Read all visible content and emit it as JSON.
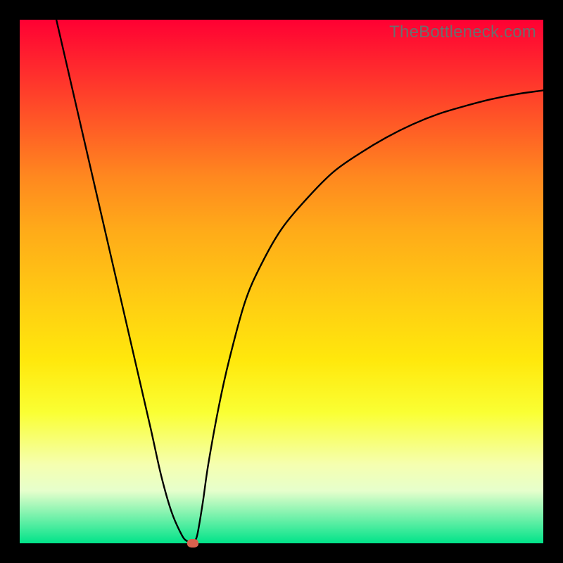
{
  "watermark": "TheBottleneck.com",
  "colors": {
    "frame": "#000000",
    "gradient_top": "#ff0033",
    "gradient_bottom": "#00e389",
    "curve": "#000000",
    "marker": "#d9614e"
  },
  "chart_data": {
    "type": "line",
    "title": "",
    "xlabel": "",
    "ylabel": "",
    "xlim": [
      0,
      100
    ],
    "ylim": [
      0,
      100
    ],
    "x": [
      7,
      10,
      13,
      16,
      19,
      22,
      25,
      27,
      29,
      31,
      32,
      33,
      33.5,
      34,
      35,
      36,
      38,
      40,
      43,
      46,
      50,
      55,
      60,
      65,
      70,
      75,
      80,
      85,
      90,
      95,
      100
    ],
    "values": [
      100,
      87,
      74,
      61,
      48,
      35,
      22,
      13,
      6,
      1.5,
      0.4,
      0,
      0.5,
      2,
      8,
      15,
      26,
      35,
      46,
      53,
      60,
      66,
      71,
      74.5,
      77.5,
      80,
      82,
      83.5,
      84.8,
      85.8,
      86.5
    ],
    "annotations": [
      {
        "type": "marker",
        "shape": "ellipse",
        "x": 33,
        "y": 0
      }
    ],
    "grid": false,
    "legend": false
  }
}
